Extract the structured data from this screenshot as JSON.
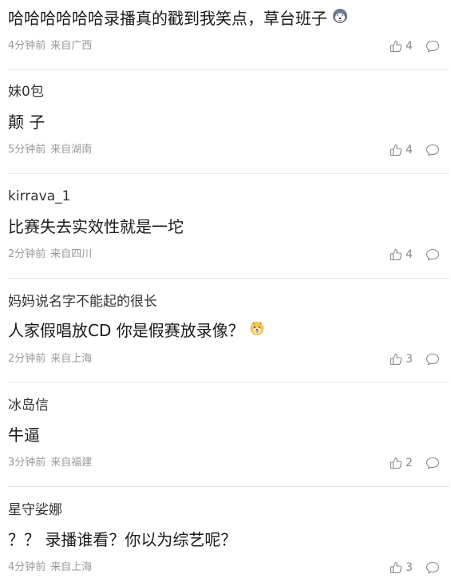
{
  "comments": [
    {
      "username": "",
      "content": "哈哈哈哈哈哈录播真的戳到我笑点，草台班子",
      "emoji": "husky-emoji",
      "time": "4分钟前",
      "location": "来自广西",
      "likes": "4"
    },
    {
      "username": "妹0包",
      "content": "颠 子",
      "emoji": "",
      "time": "5分钟前",
      "location": "来自湖南",
      "likes": "4"
    },
    {
      "username": "kirrava_1",
      "content": "比赛失去实效性就是一坨",
      "emoji": "",
      "time": "2分钟前",
      "location": "来自四川",
      "likes": "4"
    },
    {
      "username": "妈妈说名字不能起的很长",
      "content": "人家假唱放CD 你是假赛放录像？",
      "emoji": "doge-emoji",
      "time": "2分钟前",
      "location": "来自上海",
      "likes": "3"
    },
    {
      "username": "冰岛信",
      "content": "牛逼",
      "emoji": "",
      "time": "3分钟前",
      "location": "来自福建",
      "likes": "2"
    },
    {
      "username": "星守娑娜",
      "content": "？？ 录播谁看？你以为综艺呢？",
      "emoji": "",
      "time": "4分钟前",
      "location": "来自上海",
      "likes": "3"
    }
  ],
  "icons": {
    "like": "thumbs-up-icon",
    "reply": "comment-bubble-icon"
  },
  "colors": {
    "text": "#1a1a1a",
    "meta": "#999999",
    "divider": "#e6e6e6"
  }
}
